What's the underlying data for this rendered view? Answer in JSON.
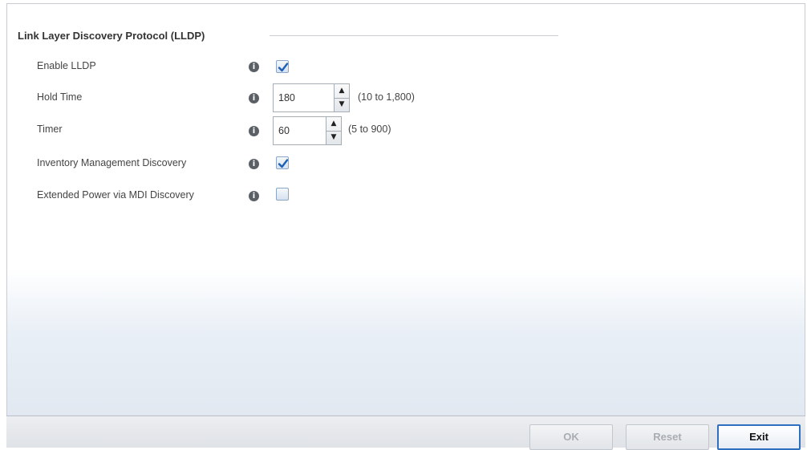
{
  "section": {
    "title": "Link Layer Discovery Protocol (LLDP)"
  },
  "fields": {
    "enable_lldp": {
      "label": "Enable LLDP",
      "checked": true
    },
    "hold_time": {
      "label": "Hold Time",
      "value": "180",
      "range": "(10 to 1,800)"
    },
    "timer": {
      "label": "Timer",
      "value": "60",
      "range": "(5 to 900)"
    },
    "inventory_mgmt": {
      "label": "Inventory Management Discovery",
      "checked": true
    },
    "extended_power": {
      "label": "Extended Power via MDI Discovery",
      "checked": false
    }
  },
  "icons": {
    "info": "info-icon",
    "spin_up": "arrow-up-icon",
    "spin_down": "arrow-down-icon",
    "check": "checkmark-icon"
  },
  "info_glyph": "i",
  "spin_glyphs": {
    "up": "▲",
    "down": "▼"
  },
  "buttons": {
    "ok": "OK",
    "reset": "Reset",
    "exit": "Exit"
  },
  "colors": {
    "accent": "#2f6fc0",
    "check": "#1f5fb4"
  }
}
